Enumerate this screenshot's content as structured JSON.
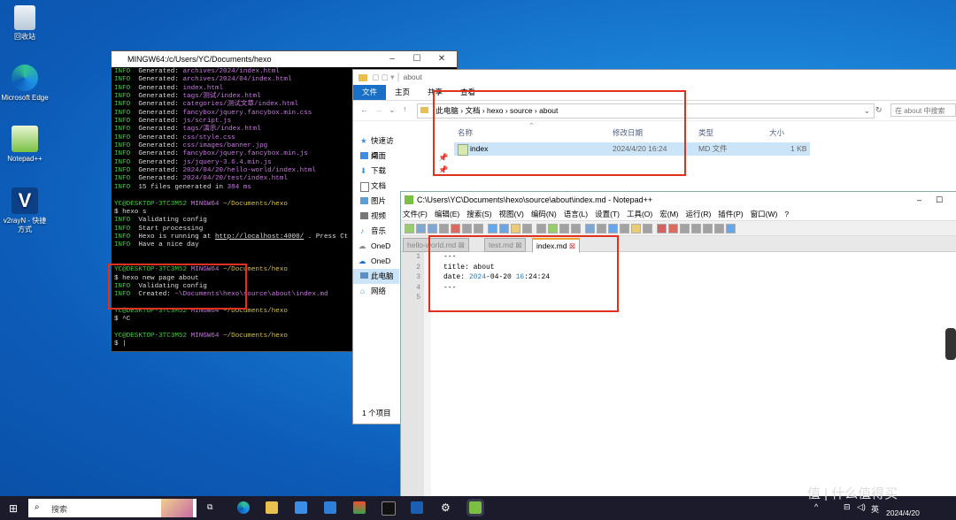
{
  "desktop": {
    "icons": [
      {
        "label": "回收站"
      },
      {
        "label": "Microsoft Edge"
      },
      {
        "label": "Notepad++"
      },
      {
        "label": "v2rayN - 快捷方式"
      }
    ]
  },
  "terminal": {
    "title": "MINGW64:/c/Users/YC/Documents/hexo",
    "lines": [
      {
        "a": "INFO",
        "b": "  Generated: ",
        "c": "archives/2024/index.html"
      },
      {
        "a": "INFO",
        "b": "  Generated: ",
        "c": "archives/2024/04/index.html"
      },
      {
        "a": "INFO",
        "b": "  Generated: ",
        "c": "index.html"
      },
      {
        "a": "INFO",
        "b": "  Generated: ",
        "c": "tags/测试/index.html"
      },
      {
        "a": "INFO",
        "b": "  Generated: ",
        "c": "categories/测试文章/index.html"
      },
      {
        "a": "INFO",
        "b": "  Generated: ",
        "c": "fancybox/jquery.fancybox.min.css"
      },
      {
        "a": "INFO",
        "b": "  Generated: ",
        "c": "js/script.js"
      },
      {
        "a": "INFO",
        "b": "  Generated: ",
        "c": "tags/演示/index.html"
      },
      {
        "a": "INFO",
        "b": "  Generated: ",
        "c": "css/style.css"
      },
      {
        "a": "INFO",
        "b": "  Generated: ",
        "c": "css/images/banner.jpg"
      },
      {
        "a": "INFO",
        "b": "  Generated: ",
        "c": "fancybox/jquery.fancybox.min.js"
      },
      {
        "a": "INFO",
        "b": "  Generated: ",
        "c": "js/jquery-3.6.4.min.js"
      },
      {
        "a": "INFO",
        "b": "  Generated: ",
        "c": "2024/04/20/hello-world/index.html"
      },
      {
        "a": "INFO",
        "b": "  Generated: ",
        "c": "2024/04/20/test/index.html"
      },
      {
        "a": "INFO",
        "b": "  15 files generated in ",
        "c": "384 ms"
      }
    ],
    "prompt_user": "YC@DESKTOP-3TC3M52",
    "prompt_env": "MINGW64",
    "prompt_path": "~/Documents/hexo",
    "cmd1": "$ hexo s",
    "s_info1": "  Validating config",
    "s_info2": "  Start processing",
    "s_info3_pre": "  Hexo is running at ",
    "s_info3_url": "http://localhost:4000/",
    "s_info3_post": " . Press Ct",
    "s_info4": "  Have a nice day",
    "cmd2": "$ hexo new page about",
    "n_info1": "  Validating config",
    "n_info2_pre": "  Created: ",
    "n_info2_path": "~\\Documents\\hexo\\source\\about\\index.md",
    "cmd3": "$ ^C",
    "cmd4": "$ |",
    "info": "INFO"
  },
  "explorer": {
    "title": "about",
    "ribbon": [
      "文件",
      "主页",
      "共享",
      "查看"
    ],
    "breadcrumb": [
      "此电脑",
      "文档",
      "hexo",
      "source",
      "about"
    ],
    "search_placeholder": "在 about 中搜索",
    "nav": [
      "快速访问",
      "桌面",
      "下载",
      "文档",
      "图片",
      "视频",
      "音乐",
      "OneD",
      "OneD",
      "此电脑",
      "网络"
    ],
    "columns": {
      "name": "名称",
      "date": "修改日期",
      "type": "类型",
      "size": "大小"
    },
    "row": {
      "name": "index",
      "date": "2024/4/20 16:24",
      "type": "MD 文件",
      "size": "1 KB"
    },
    "status": "1 个项目"
  },
  "notepad": {
    "title": "C:\\Users\\YC\\Documents\\hexo\\source\\about\\index.md - Notepad++",
    "menu": [
      "文件(F)",
      "编辑(E)",
      "搜索(S)",
      "视图(V)",
      "编码(N)",
      "语言(L)",
      "设置(T)",
      "工具(O)",
      "宏(M)",
      "运行(R)",
      "插件(P)",
      "窗口(W)",
      "?"
    ],
    "tabs": [
      "hello-world.md",
      "test.md",
      "index.md"
    ],
    "line_numbers": [
      "1",
      "2",
      "3",
      "4",
      "5"
    ],
    "l1": "---",
    "l2": "title: about",
    "l3_a": "date: ",
    "l3_b": "2024",
    "l3_c": "-04-20 ",
    "l3_d": "16",
    "l3_e": ":24:24",
    "l4": "---"
  },
  "taskbar": {
    "search": "搜索",
    "ime": "英",
    "date": "2024/4/20",
    "watermark": "值 | 什么值得买"
  },
  "colors": {
    "accent": "#1a6fc7",
    "highlight_box": "#e0301e"
  }
}
